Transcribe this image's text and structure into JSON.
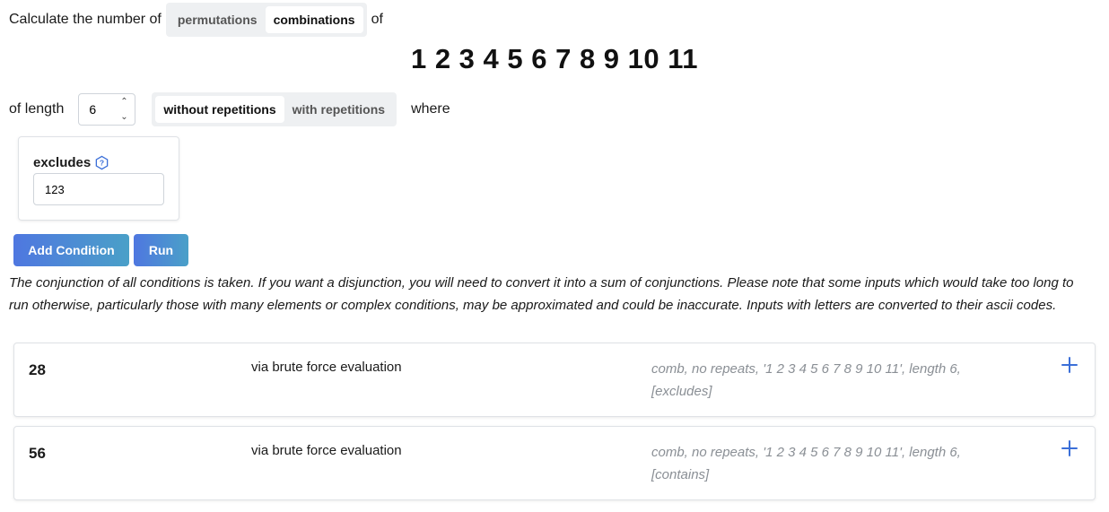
{
  "header": {
    "prefix": "Calculate the number of",
    "modes": [
      "permutations",
      "combinations"
    ],
    "active_mode": "combinations",
    "suffix": "of"
  },
  "elements_display": "1 2 3 4 5 6 7 8 9 10 11",
  "length_row": {
    "prefix": "of length",
    "length_value": "6",
    "repetition_options": [
      "without repetitions",
      "with repetitions"
    ],
    "active_repetition": "without repetitions",
    "suffix": "where"
  },
  "condition": {
    "label": "excludes",
    "value": "123",
    "help_icon": "question-circle-icon"
  },
  "buttons": {
    "add_condition": "Add Condition",
    "run": "Run"
  },
  "note": "The conjunction of all conditions is taken. If you want a disjunction, you will need to convert it into a sum of conjunctions. Please note that some inputs which would take too long to run otherwise, particularly those with many elements or complex conditions, may be approximated and could be inaccurate. Inputs with letters are converted to their ascii codes.",
  "results": [
    {
      "count": "28",
      "method": "via brute force evaluation",
      "description": "comb, no repeats, '1 2 3 4 5 6 7 8 9 10 11', length 6, [excludes]"
    },
    {
      "count": "56",
      "method": "via brute force evaluation",
      "description": "comb, no repeats, '1 2 3 4 5 6 7 8 9 10 11', length 6, [contains]"
    }
  ],
  "colors": {
    "accent": "#4f77e0",
    "button_gradient_end": "#4aa0c8",
    "muted_text": "#8a8f95"
  }
}
